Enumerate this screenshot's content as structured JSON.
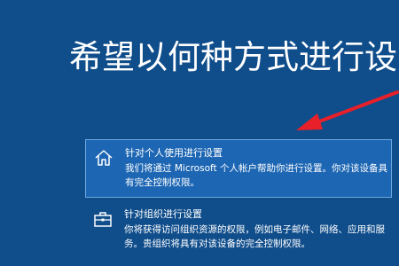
{
  "setup": {
    "title": "希望以何种方式进行设置?",
    "options": [
      {
        "icon": "home-icon",
        "title": "针对个人使用进行设置",
        "description": "我们将通过 Microsoft 个人帐户帮助你进行设置。你对该设备具有完全控制权限。",
        "selected": true
      },
      {
        "icon": "briefcase-icon",
        "title": "针对组织进行设置",
        "description": "你将获得访问组织资源的权限，例如电子邮件、网络、应用和服务。贵组织将具有对该设备的完全控制权限。",
        "selected": false
      }
    ]
  },
  "colors": {
    "background": "#0f4d8b",
    "selected_option": "#1d66b3",
    "annotation_arrow": "#e8202a"
  }
}
